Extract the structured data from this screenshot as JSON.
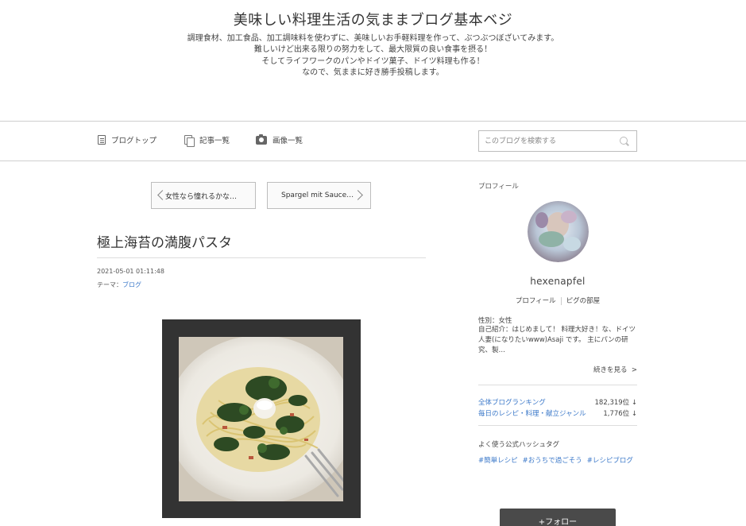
{
  "header": {
    "title": "美味しい料理生活の気ままブログ基本ベジ",
    "description_lines": [
      "調理食材、加工食品、加工調味料を使わずに、美味しいお手軽料理を作って、ぶつぶつぼざいてみます。",
      "難しいけど出来る限りの努力をして、最大限質の良い食事を摂る！",
      "そしてライフワークのパンやドイツ菓子、ドイツ料理も作る！",
      "なので、気ままに好き勝手投稿します。"
    ]
  },
  "nav": {
    "items": [
      {
        "label": "ブログトップ",
        "icon": "document-icon"
      },
      {
        "label": "記事一覧",
        "icon": "entries-icon"
      },
      {
        "label": "画像一覧",
        "icon": "camera-icon"
      }
    ],
    "search": {
      "placeholder": "このブログを検索する",
      "icon": "search-icon"
    }
  },
  "pager": {
    "prev_label": "女性なら憧れるかな…",
    "next_label": "Spargel mit Sauce…"
  },
  "entry": {
    "title": "極上海苔の満腹パスタ",
    "datetime": "2021-05-01 01:11:48",
    "theme_prefix": "テーマ：",
    "theme": "ブログ"
  },
  "sidebar": {
    "profile_heading": "プロフィール",
    "name": "hexenapfel",
    "links": [
      "プロフィール",
      "ピグの部屋"
    ],
    "gender": "性別：女性",
    "bio": "自己紹介：はじめまして！ 料理大好き！な、ドイツ人妻(になりたいwww)Asaji です。 主にパンの研究、製…",
    "more_label": "続きを見る",
    "rankings": [
      {
        "name": "全体ブログランキング",
        "value": "182,319位",
        "trend": "↓"
      },
      {
        "name": "毎日のレシピ・料理・献立ジャンル",
        "value": "1,776位",
        "trend": "↓"
      }
    ],
    "hashtag_heading": "よく使う公式ハッシュタグ",
    "hashtags": [
      "#簡単レシピ",
      "#おうちで過ごそう",
      "#レシピブログ"
    ],
    "follow_label": "+フォロー"
  },
  "colors": {
    "link": "#3b78c9",
    "follow_button": "#4a4a4a",
    "image_frame": "#333333"
  }
}
